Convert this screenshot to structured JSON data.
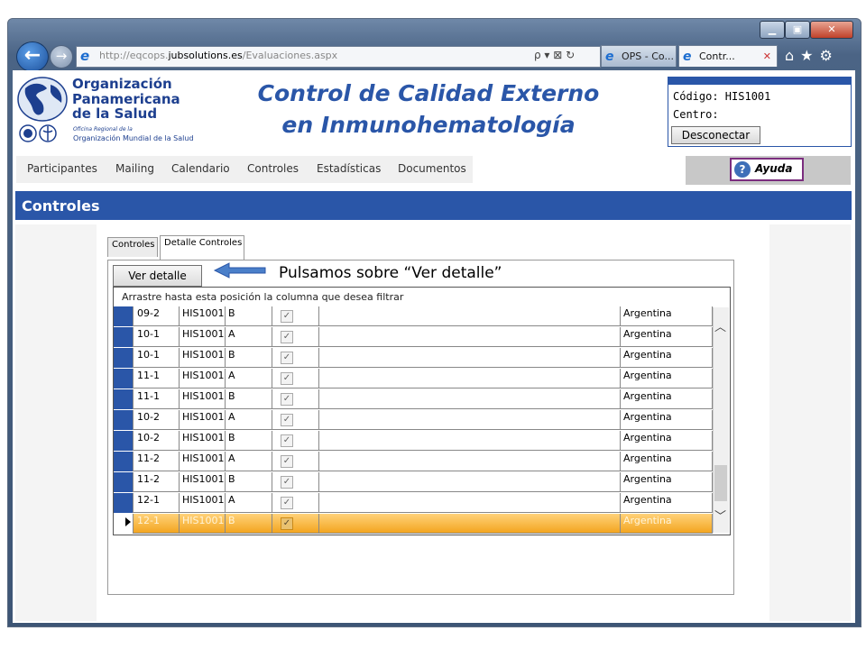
{
  "browser": {
    "address_prefix": "http://eqcops.",
    "address_domain": "jubsolutions.es",
    "address_path": "/Evaluaciones.aspx",
    "address_tools": "ρ ▾ ⊠ ↻",
    "tabs": [
      {
        "label": "OPS - Co..."
      },
      {
        "label": "Contr..."
      }
    ],
    "tab_close": "✕",
    "window_controls": [
      "▁",
      "▣",
      "✕"
    ],
    "right_icons": "⌂★⚙"
  },
  "header": {
    "org_line1": "Organización",
    "org_line2": "Panamericana",
    "org_line3": "de la Salud",
    "org_sub1": "Oficina Regional de la",
    "org_sub2": "Organización Mundial de la Salud",
    "title_line1": "Control de Calidad Externo",
    "title_line2": "en Inmunohematología",
    "codigo": "Código: HIS1001",
    "centro": "Centro:",
    "logout_label": "Desconectar"
  },
  "menu": {
    "items": [
      "Participantes",
      "Mailing",
      "Calendario",
      "Controles",
      "Estadísticas",
      "Documentos"
    ],
    "help_label": "Ayuda",
    "help_icon": "?"
  },
  "section": {
    "title": "Controles"
  },
  "panel": {
    "tabs": [
      "Controles",
      "Detalle Controles"
    ],
    "detail_button": "Ver detalle",
    "annotation": "Pulsamos sobre “Ver detalle”",
    "group_hint": "Arrastre hasta esta posición la columna que desea filtrar"
  },
  "grid": {
    "rows": [
      {
        "control": "09-2",
        "code": "HIS1001",
        "type": "B",
        "checked": "✓",
        "country": "Argentina"
      },
      {
        "control": "10-1",
        "code": "HIS1001",
        "type": "A",
        "checked": "✓",
        "country": "Argentina"
      },
      {
        "control": "10-1",
        "code": "HIS1001",
        "type": "B",
        "checked": "✓",
        "country": "Argentina"
      },
      {
        "control": "11-1",
        "code": "HIS1001",
        "type": "A",
        "checked": "✓",
        "country": "Argentina"
      },
      {
        "control": "11-1",
        "code": "HIS1001",
        "type": "B",
        "checked": "✓",
        "country": "Argentina"
      },
      {
        "control": "10-2",
        "code": "HIS1001",
        "type": "A",
        "checked": "✓",
        "country": "Argentina"
      },
      {
        "control": "10-2",
        "code": "HIS1001",
        "type": "B",
        "checked": "✓",
        "country": "Argentina"
      },
      {
        "control": "11-2",
        "code": "HIS1001",
        "type": "A",
        "checked": "✓",
        "country": "Argentina"
      },
      {
        "control": "11-2",
        "code": "HIS1001",
        "type": "B",
        "checked": "✓",
        "country": "Argentina"
      },
      {
        "control": "12-1",
        "code": "HIS1001",
        "type": "A",
        "checked": "✓",
        "country": "Argentina"
      },
      {
        "control": "12-1",
        "code": "HIS1001",
        "type": "B",
        "checked": "✓",
        "country": "Argentina"
      }
    ],
    "scroll_up": "︿",
    "scroll_down": "﹀"
  },
  "colors": {
    "brand_blue": "#2a56a8",
    "selected_row": "#f3a520",
    "help_border": "#7b2d7e"
  }
}
